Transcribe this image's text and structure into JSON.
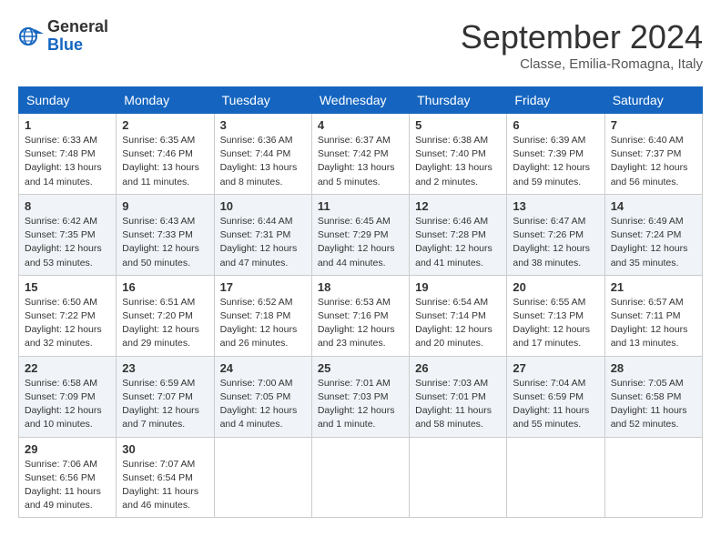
{
  "logo": {
    "general": "General",
    "blue": "Blue"
  },
  "header": {
    "month_title": "September 2024",
    "subtitle": "Classe, Emilia-Romagna, Italy"
  },
  "weekdays": [
    "Sunday",
    "Monday",
    "Tuesday",
    "Wednesday",
    "Thursday",
    "Friday",
    "Saturday"
  ],
  "weeks": [
    [
      {
        "day": "1",
        "sunrise": "6:33 AM",
        "sunset": "7:48 PM",
        "daylight": "13 hours and 14 minutes."
      },
      {
        "day": "2",
        "sunrise": "6:35 AM",
        "sunset": "7:46 PM",
        "daylight": "13 hours and 11 minutes."
      },
      {
        "day": "3",
        "sunrise": "6:36 AM",
        "sunset": "7:44 PM",
        "daylight": "13 hours and 8 minutes."
      },
      {
        "day": "4",
        "sunrise": "6:37 AM",
        "sunset": "7:42 PM",
        "daylight": "13 hours and 5 minutes."
      },
      {
        "day": "5",
        "sunrise": "6:38 AM",
        "sunset": "7:40 PM",
        "daylight": "13 hours and 2 minutes."
      },
      {
        "day": "6",
        "sunrise": "6:39 AM",
        "sunset": "7:39 PM",
        "daylight": "12 hours and 59 minutes."
      },
      {
        "day": "7",
        "sunrise": "6:40 AM",
        "sunset": "7:37 PM",
        "daylight": "12 hours and 56 minutes."
      }
    ],
    [
      {
        "day": "8",
        "sunrise": "6:42 AM",
        "sunset": "7:35 PM",
        "daylight": "12 hours and 53 minutes."
      },
      {
        "day": "9",
        "sunrise": "6:43 AM",
        "sunset": "7:33 PM",
        "daylight": "12 hours and 50 minutes."
      },
      {
        "day": "10",
        "sunrise": "6:44 AM",
        "sunset": "7:31 PM",
        "daylight": "12 hours and 47 minutes."
      },
      {
        "day": "11",
        "sunrise": "6:45 AM",
        "sunset": "7:29 PM",
        "daylight": "12 hours and 44 minutes."
      },
      {
        "day": "12",
        "sunrise": "6:46 AM",
        "sunset": "7:28 PM",
        "daylight": "12 hours and 41 minutes."
      },
      {
        "day": "13",
        "sunrise": "6:47 AM",
        "sunset": "7:26 PM",
        "daylight": "12 hours and 38 minutes."
      },
      {
        "day": "14",
        "sunrise": "6:49 AM",
        "sunset": "7:24 PM",
        "daylight": "12 hours and 35 minutes."
      }
    ],
    [
      {
        "day": "15",
        "sunrise": "6:50 AM",
        "sunset": "7:22 PM",
        "daylight": "12 hours and 32 minutes."
      },
      {
        "day": "16",
        "sunrise": "6:51 AM",
        "sunset": "7:20 PM",
        "daylight": "12 hours and 29 minutes."
      },
      {
        "day": "17",
        "sunrise": "6:52 AM",
        "sunset": "7:18 PM",
        "daylight": "12 hours and 26 minutes."
      },
      {
        "day": "18",
        "sunrise": "6:53 AM",
        "sunset": "7:16 PM",
        "daylight": "12 hours and 23 minutes."
      },
      {
        "day": "19",
        "sunrise": "6:54 AM",
        "sunset": "7:14 PM",
        "daylight": "12 hours and 20 minutes."
      },
      {
        "day": "20",
        "sunrise": "6:55 AM",
        "sunset": "7:13 PM",
        "daylight": "12 hours and 17 minutes."
      },
      {
        "day": "21",
        "sunrise": "6:57 AM",
        "sunset": "7:11 PM",
        "daylight": "12 hours and 13 minutes."
      }
    ],
    [
      {
        "day": "22",
        "sunrise": "6:58 AM",
        "sunset": "7:09 PM",
        "daylight": "12 hours and 10 minutes."
      },
      {
        "day": "23",
        "sunrise": "6:59 AM",
        "sunset": "7:07 PM",
        "daylight": "12 hours and 7 minutes."
      },
      {
        "day": "24",
        "sunrise": "7:00 AM",
        "sunset": "7:05 PM",
        "daylight": "12 hours and 4 minutes."
      },
      {
        "day": "25",
        "sunrise": "7:01 AM",
        "sunset": "7:03 PM",
        "daylight": "12 hours and 1 minute."
      },
      {
        "day": "26",
        "sunrise": "7:03 AM",
        "sunset": "7:01 PM",
        "daylight": "11 hours and 58 minutes."
      },
      {
        "day": "27",
        "sunrise": "7:04 AM",
        "sunset": "6:59 PM",
        "daylight": "11 hours and 55 minutes."
      },
      {
        "day": "28",
        "sunrise": "7:05 AM",
        "sunset": "6:58 PM",
        "daylight": "11 hours and 52 minutes."
      }
    ],
    [
      {
        "day": "29",
        "sunrise": "7:06 AM",
        "sunset": "6:56 PM",
        "daylight": "11 hours and 49 minutes."
      },
      {
        "day": "30",
        "sunrise": "7:07 AM",
        "sunset": "6:54 PM",
        "daylight": "11 hours and 46 minutes."
      },
      null,
      null,
      null,
      null,
      null
    ]
  ],
  "labels": {
    "sunrise": "Sunrise:",
    "sunset": "Sunset:",
    "daylight": "Daylight:"
  }
}
